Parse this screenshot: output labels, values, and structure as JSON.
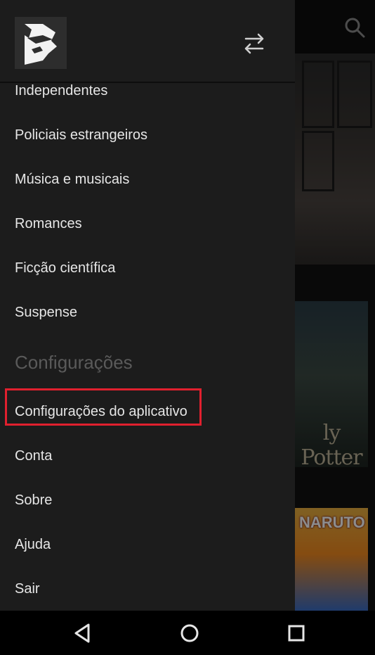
{
  "drawer": {
    "items": [
      {
        "label": "Independentes"
      },
      {
        "label": "Policiais estrangeiros"
      },
      {
        "label": "Música e musicais"
      },
      {
        "label": "Romances"
      },
      {
        "label": "Ficção científica"
      },
      {
        "label": "Suspense"
      }
    ],
    "section_title": "Configurações",
    "settings_items": [
      {
        "label": "Configurações do aplicativo"
      },
      {
        "label": "Conta"
      },
      {
        "label": "Sobre"
      },
      {
        "label": "Ajuda"
      },
      {
        "label": "Sair"
      }
    ]
  },
  "background": {
    "poster1_title": "ly Potter",
    "poster2_title": "NARUTO"
  },
  "colors": {
    "drawer_bg": "#1c1c1c",
    "highlight": "#e0202e",
    "section_text": "#5a5a5a"
  }
}
